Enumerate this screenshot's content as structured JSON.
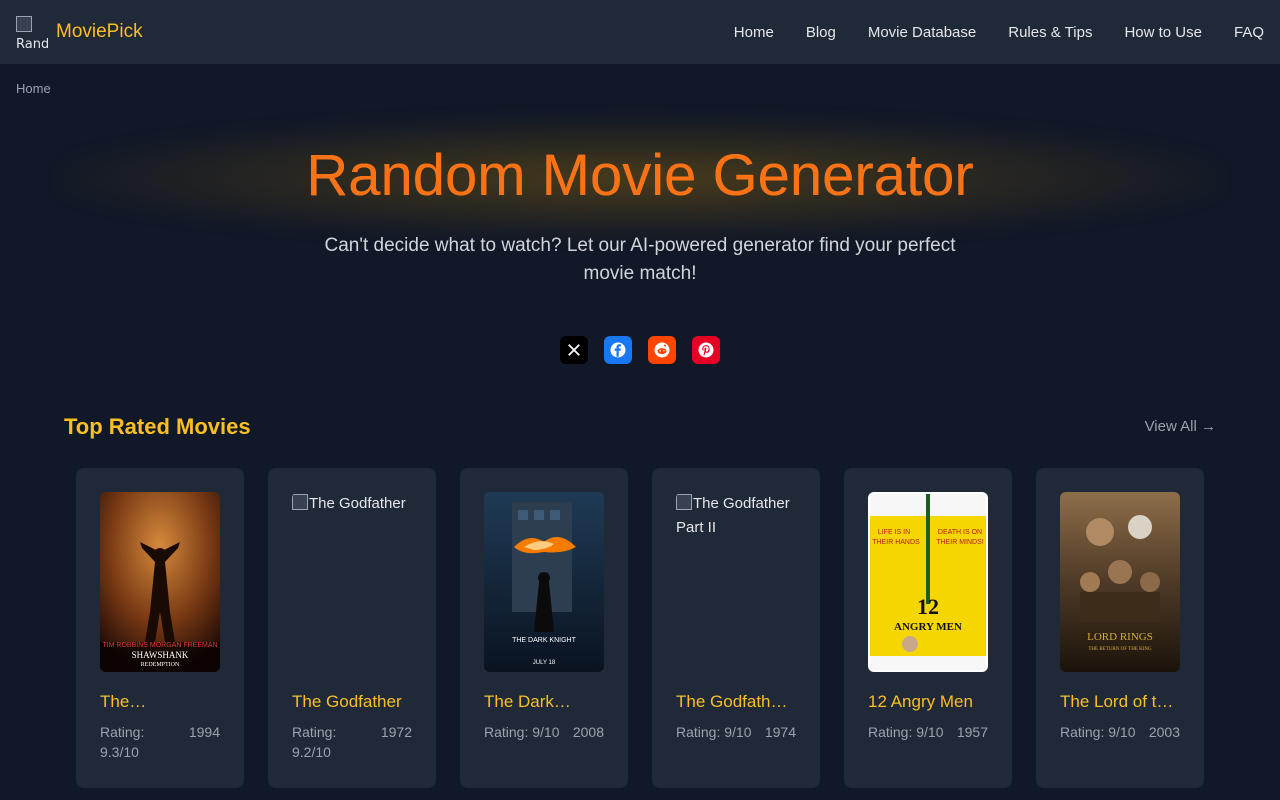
{
  "header": {
    "logo_alt": "Rand",
    "brand": "MoviePick",
    "nav": [
      "Home",
      "Blog",
      "Movie Database",
      "Rules & Tips",
      "How to Use",
      "FAQ"
    ]
  },
  "breadcrumb": "Home",
  "hero": {
    "title": "Random Movie Generator",
    "subtitle": "Can't decide what to watch? Let our AI-powered generator find your perfect movie match!"
  },
  "share_icons": [
    "x-icon",
    "facebook-icon",
    "reddit-icon",
    "pinterest-icon"
  ],
  "section": {
    "title": "Top Rated Movies",
    "view_all": "View All →"
  },
  "movies": [
    {
      "title": "The Shawshank Redemption",
      "display_title": "The…",
      "rating": "Rating: 9.3/10",
      "year": "1994",
      "poster": "shawshank"
    },
    {
      "title": "The Godfather",
      "display_title": "The Godfather",
      "rating": "Rating: 9.2/10",
      "year": "1972",
      "poster_alt": "The Godfather"
    },
    {
      "title": "The Dark Knight",
      "display_title": "The Dark…",
      "rating": "Rating: 9/10",
      "year": "2008",
      "poster": "darkknight"
    },
    {
      "title": "The Godfather Part II",
      "display_title": "The Godfath…",
      "rating": "Rating: 9/10",
      "year": "1974",
      "poster_alt": "The Godfather Part II"
    },
    {
      "title": "12 Angry Men",
      "display_title": "12 Angry Men",
      "rating": "Rating: 9/10",
      "year": "1957",
      "poster": "angrymen"
    },
    {
      "title": "The Lord of the Rings",
      "display_title": "The Lord of t…",
      "rating": "Rating: 9/10",
      "year": "2003",
      "poster": "lotr"
    }
  ],
  "colors": {
    "background": "#111827",
    "header": "#1f2937",
    "accent": "#fbbf24",
    "title": "#f97316"
  }
}
